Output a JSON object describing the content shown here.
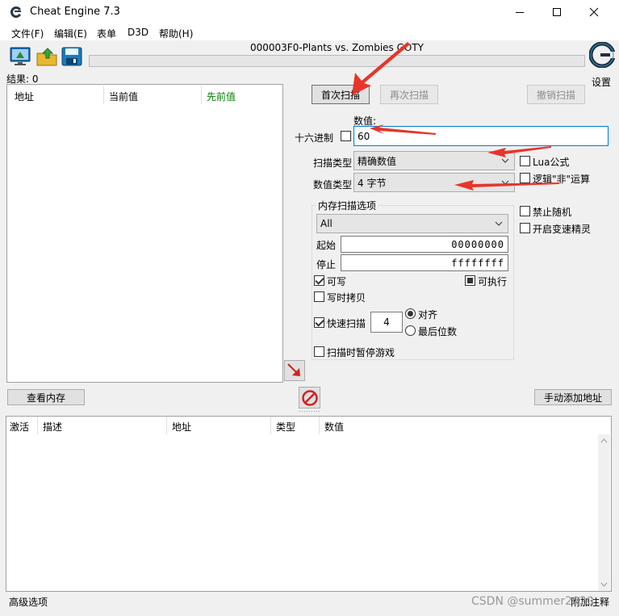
{
  "window": {
    "title": "Cheat Engine 7.3",
    "controls": {
      "minimize": "minimize",
      "maximize": "maximize",
      "close": "close"
    }
  },
  "menu": [
    "文件(F)",
    "编辑(E)",
    "表单",
    "D3D",
    "帮助(H)"
  ],
  "toolbar": {
    "process_title": "000003F0-Plants vs. Zombies GOTY",
    "settings_label": "设置"
  },
  "results": {
    "count_label": "结果: 0",
    "columns": [
      "地址",
      "当前值",
      "先前值"
    ],
    "previous_color": "#008000"
  },
  "scan": {
    "first_scan": "首次扫描",
    "next_scan": "再次扫描",
    "undo_scan": "撤销扫描",
    "value_label": "数值:",
    "hex_label": "十六进制",
    "value": "60",
    "scan_type_label": "扫描类型",
    "scan_type": "精确数值",
    "value_type_label": "数值类型",
    "value_type": "4 字节",
    "lua_formula": "Lua公式",
    "logical_not": "逻辑\"非\"运算"
  },
  "memory_options": {
    "title": "内存扫描选项",
    "region": "All",
    "start_label": "起始",
    "start": "00000000",
    "stop_label": "停止",
    "stop": "ffffffff",
    "writable": "可写",
    "executable": "可执行",
    "copy_on_write": "写时拷贝",
    "fast_scan": "快速扫描",
    "fast_scan_value": "4",
    "alignment": "对齐",
    "last_digits": "最后位数",
    "pause_game": "扫描时暂停游戏"
  },
  "side_options": {
    "disable_random": "禁止随机",
    "speedhack": "开启变速精灵"
  },
  "actions": {
    "memory_view": "查看内存",
    "add_address": "手动添加地址"
  },
  "address_table": {
    "columns": [
      "激活",
      "描述",
      "地址",
      "类型",
      "数值"
    ]
  },
  "status": {
    "advanced": "高级选项",
    "table_extras": "附加注释"
  },
  "watermark": "CSDN @summer2020",
  "colors": {
    "annotation_arrow": "#e8342a",
    "focus_border": "#0078d7"
  }
}
